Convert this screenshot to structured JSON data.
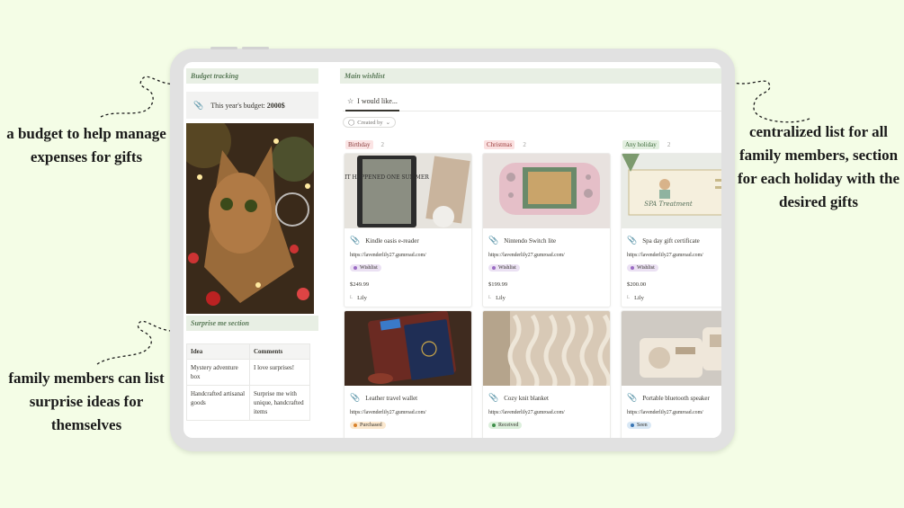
{
  "annotations": {
    "budget": "a budget to help manage expenses for gifts",
    "surprise": "family members can list surprise ideas for themselves",
    "central": "centralized list for all family members, section for each holiday with the desired gifts"
  },
  "left": {
    "budget_heading": "Budget tracking",
    "budget_text": "This year's budget:",
    "budget_value": "2000$",
    "surprise_heading": "Surprise me section",
    "table": {
      "headers": [
        "Idea",
        "Comments"
      ],
      "rows": [
        [
          "Mystery adventure box",
          "I love surprises!"
        ],
        [
          "Handcrafted artisanal goods",
          "Surprise me with unique, handcrafted items"
        ]
      ]
    }
  },
  "main": {
    "heading": "Main wishlist",
    "tab_label": "I would like...",
    "filter_label": "Created by",
    "groups": [
      {
        "name": "Birthday",
        "count": "2",
        "color": "#fbe4e4",
        "text_color": "#8a3c3c"
      },
      {
        "name": "Christmas",
        "count": "2",
        "color": "#fbe0e0",
        "text_color": "#9a3a3a"
      },
      {
        "name": "Any holiday",
        "count": "2",
        "color": "#e3efe0",
        "text_color": "#3d6b3a"
      }
    ],
    "cards": [
      {
        "title": "Kindle oasis e-reader",
        "url": "https://lavenderlily27.gumroad.com/",
        "status": "Wishlist",
        "price": "$249.99",
        "person": "Lily"
      },
      {
        "title": "Nintendo Switch lite",
        "url": "https://lavenderlily27.gumroad.com/",
        "status": "Wishlist",
        "price": "$199.99",
        "person": "Lily"
      },
      {
        "title": "Spa day gift certificate",
        "url": "https://lavenderlily27.gumroad.com/",
        "status": "Wishlist",
        "price": "$200.00",
        "person": "Lily"
      },
      {
        "title": "Leather travel wallet",
        "url": "https://lavenderlily27.gumroad.com/",
        "status": "Purchased"
      },
      {
        "title": "Cozy knit blanket",
        "url": "https://lavenderlily27.gumroad.com/",
        "status": "Received"
      },
      {
        "title": "Portable bluetooth speaker",
        "url": "https://lavenderlily27.gumroad.com/",
        "status": "Seen"
      }
    ],
    "book_cover_text": "IT HAPPENED ONE SUMMER",
    "spa_card_text": "SPA Treatment"
  },
  "colors": {
    "background": "#f4fde6",
    "wishlist_bg": "#ebe1f3",
    "wishlist_dot": "#9b6bc4",
    "purchased_bg": "#fbe8cf",
    "purchased_dot": "#d9822b",
    "received_bg": "#dcefdc",
    "received_dot": "#3f8f4a",
    "seen_bg": "#d9e8f5",
    "seen_dot": "#3a76b4"
  }
}
